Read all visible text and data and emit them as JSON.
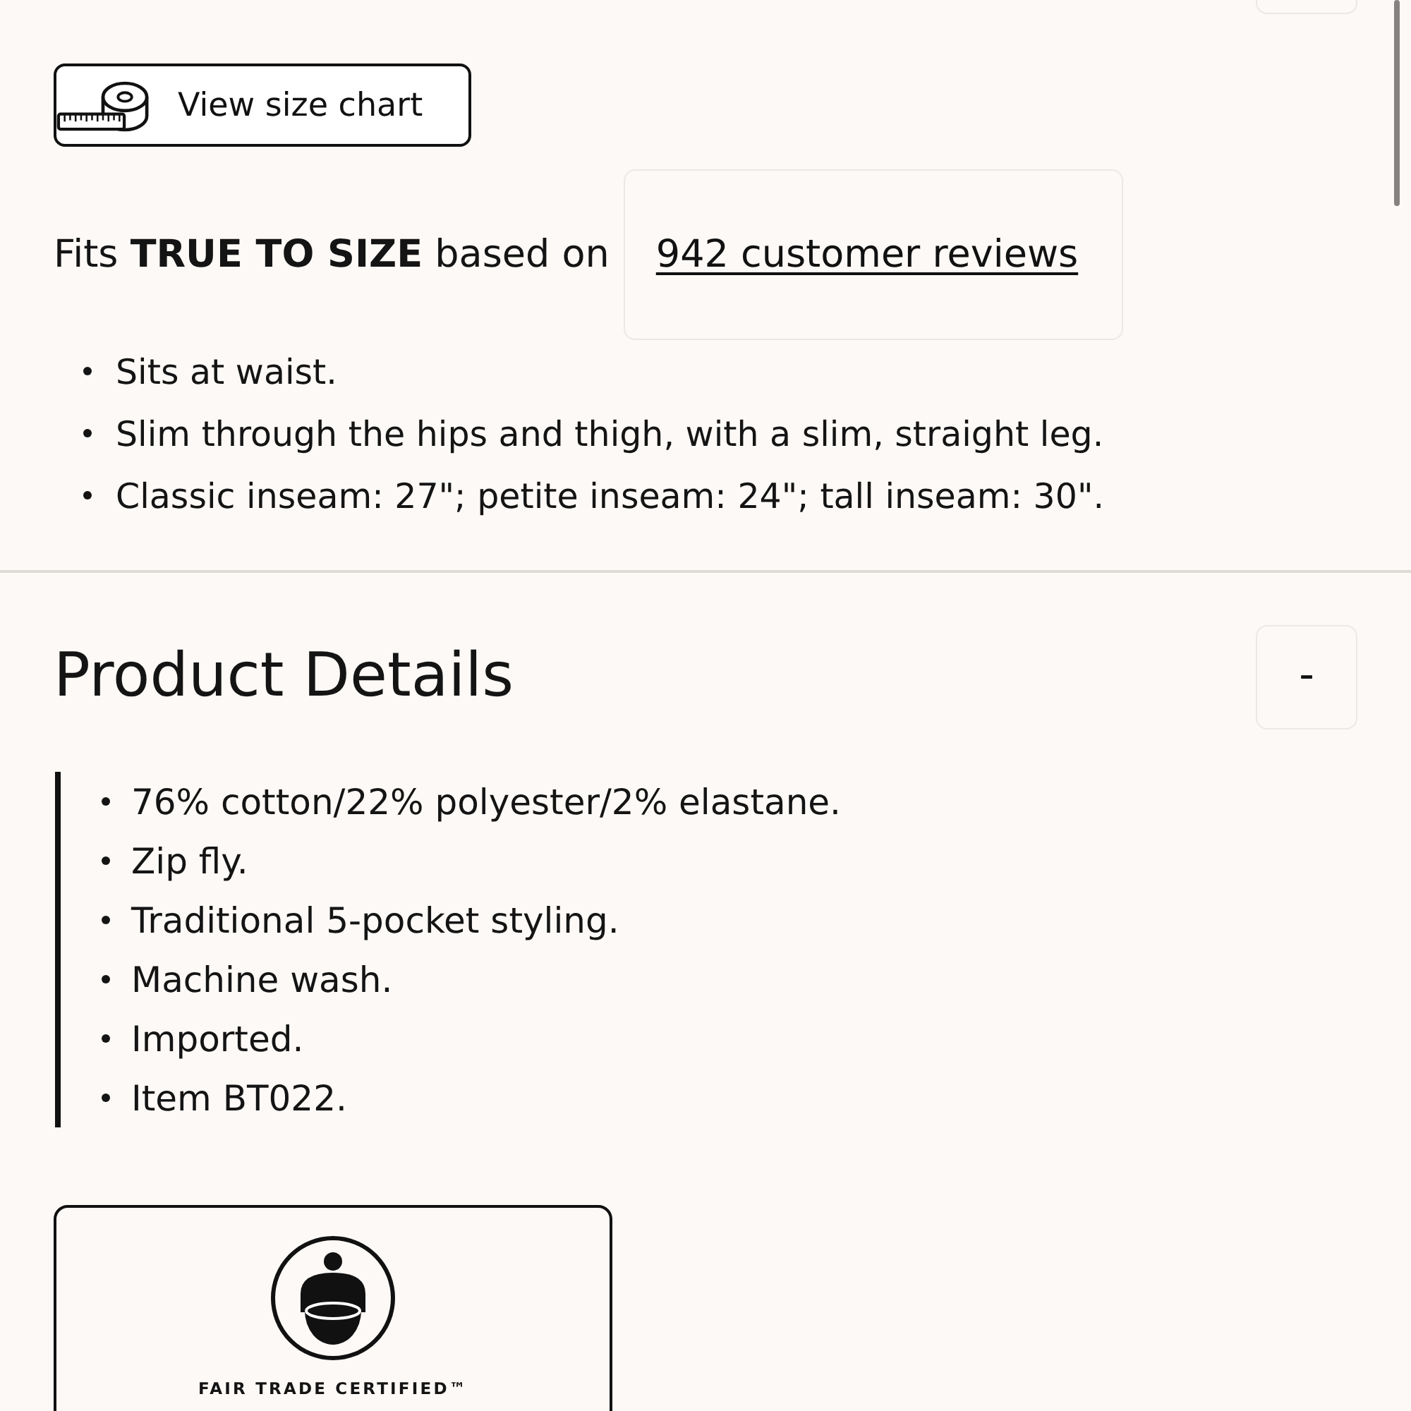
{
  "size_chart_button": {
    "label": "View size chart"
  },
  "fit_summary": {
    "text": "Fits **TRUE TO SIZE** based on",
    "reviews_link": "942 customer reviews"
  },
  "fit_notes": [
    "Sits at waist.",
    "Slim through the hips and thigh, with a slim, straight leg.",
    "Classic inseam: 27\"; petite inseam: 24\"; tall inseam: 30\"."
  ],
  "product_details": {
    "title": "Product Details",
    "toggle_label": "-",
    "expanded": true,
    "items": [
      "76% cotton/22% polyester/2% elastane.",
      "Zip fly.",
      "Traditional 5-pocket styling.",
      "Machine wash.",
      "Imported.",
      "Item BT022."
    ]
  },
  "certification": {
    "label": "FAIR TRADE CERTIFIED™"
  }
}
